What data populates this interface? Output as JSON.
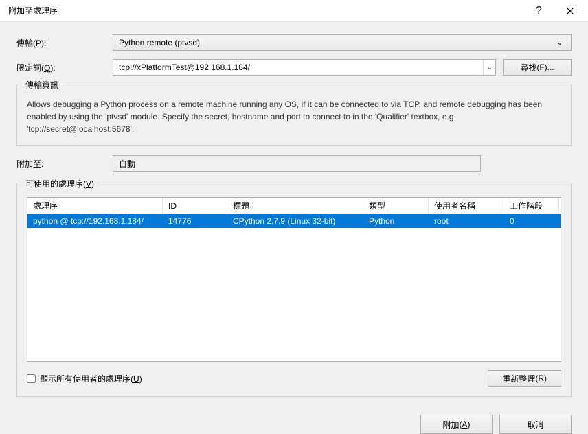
{
  "title": "附加至處理序",
  "labels": {
    "transport": "傳輸",
    "transport_accel": "P",
    "qualifier": "限定詞",
    "qualifier_accel": "Q",
    "attach_to": "附加至:"
  },
  "transport": {
    "selected": "Python remote (ptvsd)"
  },
  "qualifier": {
    "value": "tcp://xPlatformTest@192.168.1.184/"
  },
  "find_button": "尋找",
  "find_accel": "F",
  "info_group": {
    "title": "傳輸資訊",
    "text": "Allows debugging a Python process on a remote machine running any OS, if it can be connected to via TCP, and remote debugging has been enabled by using the 'ptvsd' module. Specify the secret, hostname and port to connect to in the 'Qualifier' textbox, e.g. 'tcp://secret@localhost:5678'."
  },
  "attach_to_value": "自動",
  "processes_group": {
    "title": "可使用的處理序",
    "title_accel": "V",
    "columns": {
      "process": "處理序",
      "id": "ID",
      "title": "標題",
      "type": "類型",
      "user": "使用者名稱",
      "session": "工作階段"
    },
    "rows": [
      {
        "process": "python @ tcp://192.168.1.184/",
        "id": "14776",
        "title": "CPython 2.7.9 (Linux 32-bit)",
        "type": "Python",
        "user": "root",
        "session": "0"
      }
    ]
  },
  "show_all_checkbox": "顯示所有使用者的處理序",
  "show_all_accel": "U",
  "refresh_button": "重新整理",
  "refresh_accel": "R",
  "attach_button": "附加",
  "attach_accel": "A",
  "cancel_button": "取消"
}
